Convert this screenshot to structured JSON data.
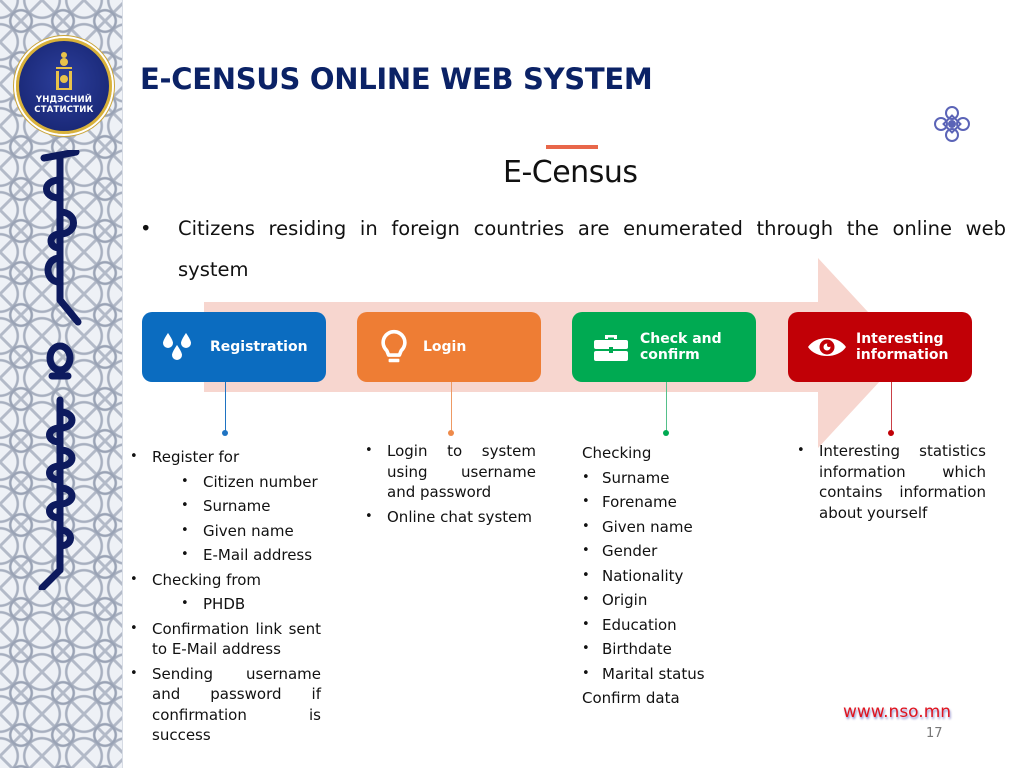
{
  "branding": {
    "logo_line1": "ҮНДЭСНИЙ",
    "logo_line2": "СТАТИСТИК",
    "vertical_script_name": "Mongolian script ornament"
  },
  "slide": {
    "title": "E-CENSUS ONLINE WEB SYSTEM",
    "subtitle": "E-Census",
    "intro_bullet": "•",
    "intro_line1": "Citizens residing in foreign countries are enumerated through the online web",
    "intro_line2": "system"
  },
  "process": {
    "steps": [
      {
        "label": "Registration",
        "icon": "droplets-icon",
        "color": "#0b6cc0"
      },
      {
        "label": "Login",
        "icon": "lightbulb-icon",
        "color": "#ee7d34"
      },
      {
        "label_line1": "Check and",
        "label_line2": "confirm",
        "icon": "briefcase-icon",
        "color": "#00aa52"
      },
      {
        "label_line1": "Interesting",
        "label_line2": "information",
        "icon": "eye-icon",
        "color": "#c10006"
      }
    ],
    "arrow_color": "#f7d6cf"
  },
  "columns": {
    "registration": [
      {
        "text": "Register for",
        "level": 1
      },
      {
        "text": "Citizen number",
        "level": 2
      },
      {
        "text": "Surname",
        "level": 2
      },
      {
        "text": "Given name",
        "level": 2
      },
      {
        "text": "E-Mail address",
        "level": 2
      },
      {
        "text": "Checking from",
        "level": 1
      },
      {
        "text": "PHDB",
        "level": 2
      },
      {
        "text": "Confirmation link sent to E-Mail address",
        "level": 1
      },
      {
        "text": "Sending username and password if confirmation is success",
        "level": 1
      }
    ],
    "login": [
      {
        "text": "Login to system using username and password"
      },
      {
        "text": "Online chat system"
      }
    ],
    "check": {
      "heading": "Checking",
      "items": [
        "Surname",
        "Forename",
        "Given name",
        "Gender",
        "Nationality",
        "Origin",
        "Education",
        "Birthdate",
        "Marital status"
      ],
      "footer": "Confirm data"
    },
    "interesting": [
      {
        "text": "Interesting statistics information which contains information about yourself"
      }
    ]
  },
  "footer": {
    "website": "www.nso.mn",
    "page_number": "17"
  }
}
